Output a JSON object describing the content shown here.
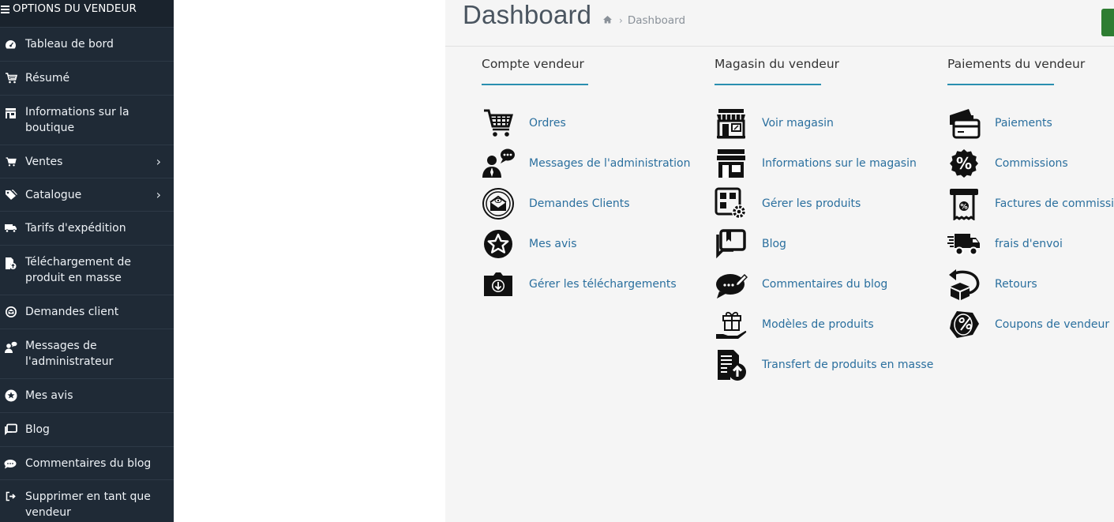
{
  "sidebar": {
    "header": "OPTIONS DU VENDEUR",
    "items": [
      {
        "label": "Tableau de bord"
      },
      {
        "label": "Résumé"
      },
      {
        "label": "Informations sur la boutique"
      },
      {
        "label": "Ventes"
      },
      {
        "label": "Catalogue"
      },
      {
        "label": "Tarifs d'expédition"
      },
      {
        "label": "Téléchargement de produit en masse"
      },
      {
        "label": "Demandes client"
      },
      {
        "label": "Messages de l'administrateur"
      },
      {
        "label": "Mes avis"
      },
      {
        "label": "Blog"
      },
      {
        "label": "Commentaires du blog"
      },
      {
        "label": "Supprimer en tant que vendeur"
      }
    ]
  },
  "header": {
    "title": "Dashboard",
    "breadcrumb": "Dashboard"
  },
  "columns": [
    {
      "title": "Compte vendeur",
      "links": [
        "Ordres",
        "Messages de l'administration",
        "Demandes Clients",
        "Mes avis",
        "Gérer les téléchargements"
      ]
    },
    {
      "title": "Magasin du vendeur",
      "links": [
        "Voir magasin",
        "Informations sur le magasin",
        "Gérer les produits",
        "Blog",
        "Commentaires du blog",
        "Modèles de produits",
        "Transfert de produits en masse"
      ]
    },
    {
      "title": "Paiements du vendeur",
      "links": [
        "Paiements",
        "Commissions",
        "Factures de commission",
        "frais d'envoi",
        "Retours",
        "Coupons de vendeur"
      ]
    }
  ],
  "colors": {
    "sidebar_bg": "#1f2a36",
    "link": "#2a6f9e",
    "accent_underline": "#2a8fb0",
    "button_green": "#2e7d32"
  }
}
